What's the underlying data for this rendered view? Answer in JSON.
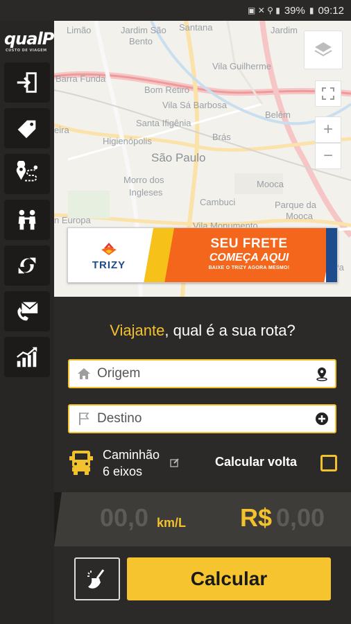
{
  "status_bar": {
    "battery": "39%",
    "time": "09:12"
  },
  "sidebar": {
    "logo_text": "qualP",
    "logo_subtext": "CUSTO DE VIAGEM",
    "items": [
      {
        "name": "login",
        "icon": "login-icon"
      },
      {
        "name": "tolls",
        "icon": "tag-icon"
      },
      {
        "name": "routes",
        "icon": "route-icon"
      },
      {
        "name": "drivers",
        "icon": "people-icon"
      },
      {
        "name": "sync",
        "icon": "sync-icon"
      },
      {
        "name": "contact",
        "icon": "mail-phone-icon"
      },
      {
        "name": "stats",
        "icon": "chart-icon"
      }
    ]
  },
  "map": {
    "labels": [
      {
        "text": "Limão"
      },
      {
        "text": "Jardim São"
      },
      {
        "text": "Bento"
      },
      {
        "text": "Santana"
      },
      {
        "text": "Jardim"
      },
      {
        "text": "Vila Guilherme"
      },
      {
        "text": "Barra Funda"
      },
      {
        "text": "Bom Retiro"
      },
      {
        "text": "Vila Sá Barbosa"
      },
      {
        "text": "Belém"
      },
      {
        "text": "eira"
      },
      {
        "text": "Santa Ifigênia"
      },
      {
        "text": "Higienópolis"
      },
      {
        "text": "Brás"
      },
      {
        "text": "São Paulo"
      },
      {
        "text": "Morro dos"
      },
      {
        "text": "Ingleses"
      },
      {
        "text": "Mooca"
      },
      {
        "text": "Cambuci"
      },
      {
        "text": "Parque da"
      },
      {
        "text": "Mooca"
      },
      {
        "text": "n Europa"
      },
      {
        "text": "Vila Monumento"
      },
      {
        "text": "Pa"
      }
    ],
    "ad": {
      "brand": "TRIZY",
      "line1": "SEU FRETE",
      "line2": "COMEÇA AQUI",
      "line3": "BAIXE O TRIZY AGORA MESMO!"
    }
  },
  "form": {
    "question_highlight": "Viajante",
    "question_rest": ", qual é a sua rota?",
    "origin_placeholder": "Origem",
    "destination_placeholder": "Destino",
    "vehicle_line1": "Caminhão",
    "vehicle_line2": "6 eixos",
    "return_label": "Calcular volta",
    "return_checked": false
  },
  "results": {
    "consumption": "00,0",
    "consumption_unit": "km/L",
    "currency": "R$",
    "price": "0,00"
  },
  "actions": {
    "calculate_label": "Calcular"
  },
  "colors": {
    "accent": "#f2c12e",
    "panel": "#2b2a28",
    "sidebar": "#272624",
    "orange": "#f4661b",
    "blue": "#1e4b8c"
  }
}
